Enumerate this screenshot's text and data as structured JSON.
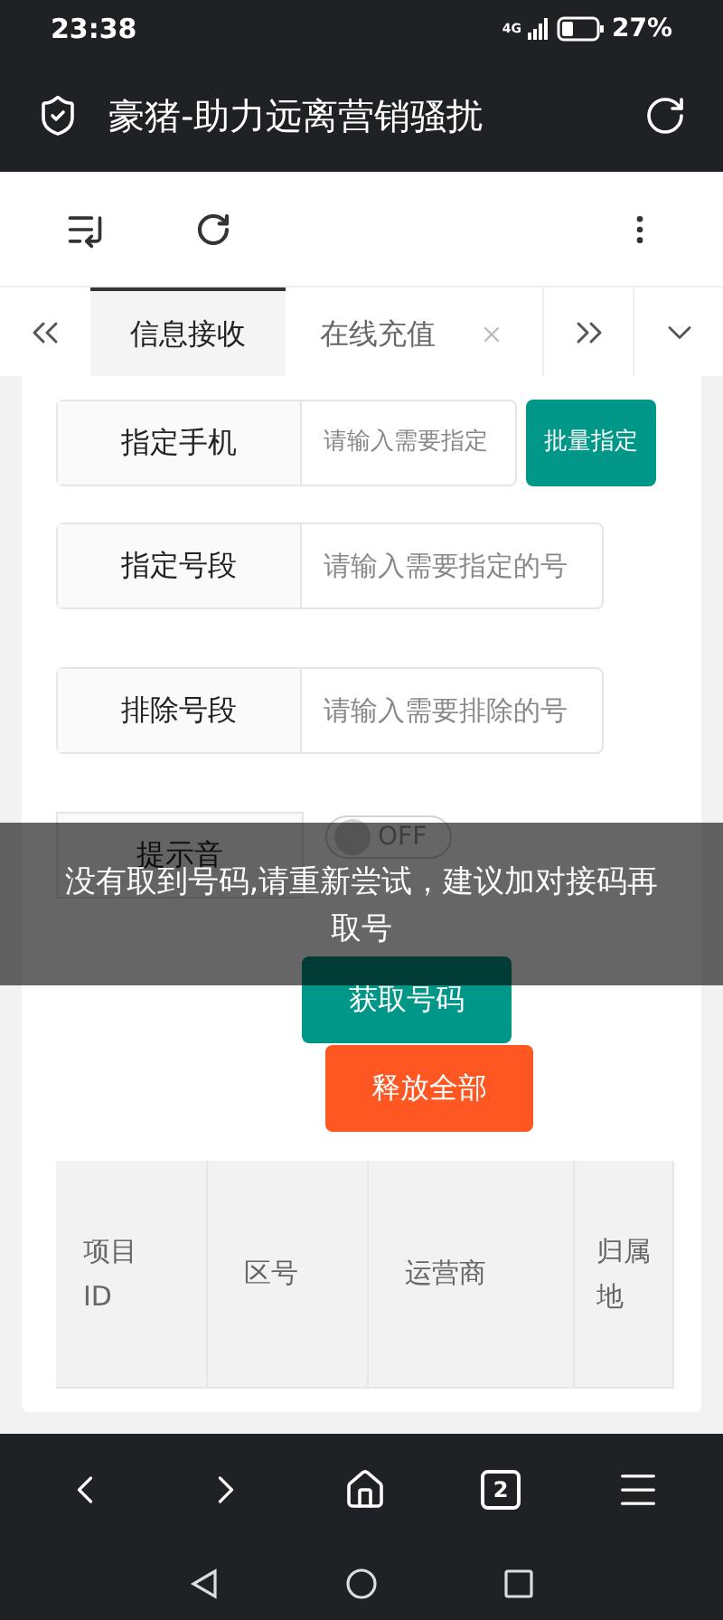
{
  "status_bar": {
    "time": "23:38",
    "network": "4G",
    "battery": "27%"
  },
  "title_bar": {
    "title": "豪猪-助力远离营销骚扰"
  },
  "tabs": [
    {
      "label": "信息接收",
      "selected": true,
      "closable": false
    },
    {
      "label": "在线充值",
      "selected": false,
      "closable": true
    }
  ],
  "form": {
    "rows": [
      {
        "label": "指定手机",
        "placeholder": "请输入需要指定",
        "button": "批量指定"
      },
      {
        "label": "指定号段",
        "placeholder": "请输入需要指定的号"
      },
      {
        "label": "排除号段",
        "placeholder": "请输入需要排除的号"
      }
    ],
    "sound": {
      "label": "提示音",
      "on": false,
      "switch_text": "OFF"
    },
    "get_button": "获取号码",
    "release_button": "释放全部"
  },
  "table": {
    "columns": [
      "项目ID",
      "区号",
      "运营商",
      "归属地"
    ]
  },
  "toast": "没有取到号码,请重新尝试，建议加对接码再取号",
  "bottom_nav": {
    "tab_count": "2"
  }
}
